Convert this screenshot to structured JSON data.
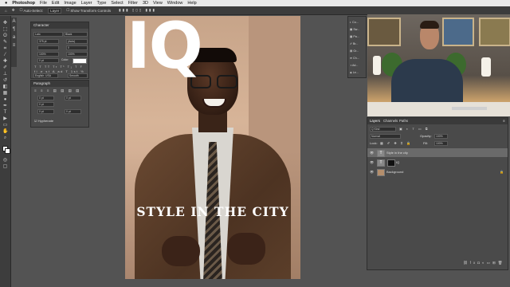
{
  "menubar": {
    "apple": "",
    "app": "Photoshop",
    "items": [
      "File",
      "Edit",
      "Image",
      "Layer",
      "Type",
      "Select",
      "Filter",
      "3D",
      "View",
      "Window",
      "Help"
    ]
  },
  "options_bar": {
    "auto_select": "Auto-Select:",
    "auto_select_value": "Layer",
    "show_transform": "Show Transform Controls"
  },
  "character_panel": {
    "title": "Character",
    "font_family": "Lato",
    "font_style": "Black",
    "font_size": "375 pt",
    "leading": "(Auto)",
    "tracking": "0",
    "vscale": "100%",
    "hscale": "100%",
    "baseline": "0 pt",
    "color_label": "Color:",
    "language": "English: USA",
    "antialias": "Smooth"
  },
  "paragraph_panel": {
    "title": "Paragraph",
    "indent_left": "0 pt",
    "indent_right": "0 pt",
    "indent_first": "0 pt",
    "space_before": "0 pt",
    "space_after": "0 pt",
    "hyphenate": "Hyphenate"
  },
  "document": {
    "masthead": "IQ",
    "cover_line": "STYLE IN THE CITY"
  },
  "properties_mini": {
    "items": [
      "Co...",
      "Sw...",
      "Pa...",
      "Br...",
      "Gr...",
      "Ch...",
      "Ad...",
      "Le..."
    ]
  },
  "layers_panel": {
    "tabs": [
      "Layers",
      "Channels",
      "Paths"
    ],
    "kind_filter": "Q Kind",
    "blend_mode": "Normal",
    "opacity_label": "Opacity:",
    "opacity": "100%",
    "lock_label": "Lock:",
    "fill_label": "Fill:",
    "fill": "100%",
    "layers": [
      {
        "name": "Style in the city",
        "type": "text",
        "selected": true
      },
      {
        "name": "IQ",
        "type": "text",
        "selected": false
      },
      {
        "name": "Background",
        "type": "image",
        "selected": false
      }
    ]
  },
  "colors": {
    "ps_dark": "#3c3c3c",
    "ps_panel": "#4a4a4a",
    "canvas_bg": "#535353",
    "selected_layer": "#6a6a6a"
  }
}
